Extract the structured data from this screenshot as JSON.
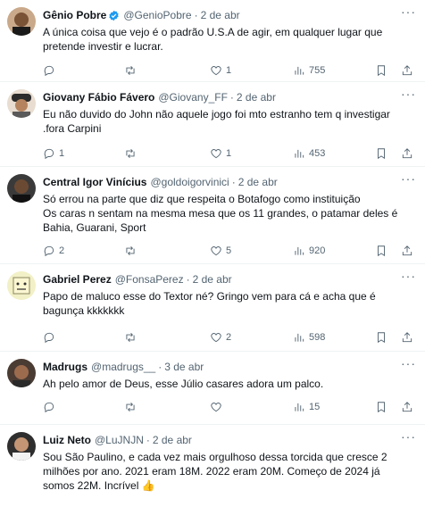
{
  "tweets": [
    {
      "name": "Gênio Pobre",
      "verified": true,
      "handle": "@GenioPobre",
      "date": "2 de abr",
      "lines": [
        "A única coisa que vejo é o padrão U.S.A de agir, em qualquer lugar que",
        "pretende investir e lucrar."
      ],
      "replies": "",
      "reposts": "",
      "likes": "1",
      "views": "755"
    },
    {
      "name": "Giovany Fábio Fávero",
      "verified": false,
      "handle": "@Giovany_FF",
      "date": "2 de abr",
      "lines": [
        "Eu não duvido do John não aquele jogo foi mto estranho tem q investigar",
        ".fora  Carpini"
      ],
      "replies": "1",
      "reposts": "",
      "likes": "1",
      "views": "453"
    },
    {
      "name": "Central Igor Vinícius",
      "verified": false,
      "handle": "@goldoigorvinici",
      "date": "2 de abr",
      "lines": [
        "Só errou na parte que diz que respeita o Botafogo como instituição",
        "Os caras n sentam na mesma mesa que os 11 grandes, o patamar deles é",
        "Bahia, Guarani, Sport"
      ],
      "replies": "2",
      "reposts": "",
      "likes": "5",
      "views": "920"
    },
    {
      "name": "Gabriel Perez",
      "verified": false,
      "handle": "@FonsaPerez",
      "date": "2 de abr",
      "lines": [
        "Papo de maluco esse do Textor né? Gringo vem para cá e acha que é",
        "bagunça kkkkkkk"
      ],
      "replies": "",
      "reposts": "",
      "likes": "2",
      "views": "598"
    },
    {
      "name": "Madrugs",
      "verified": false,
      "handle": "@madrugs__",
      "date": "3 de abr",
      "lines": [
        "Ah pelo amor de Deus, esse Júlio casares adora um palco."
      ],
      "replies": "",
      "reposts": "",
      "likes": "",
      "views": "15"
    },
    {
      "name": "Luiz Neto",
      "verified": false,
      "handle": "@LuJNJN",
      "date": "2 de abr",
      "lines": [
        "Sou São Paulino, e cada vez mais orgulhoso dessa torcida que cresce 2",
        "milhões por ano. 2021 eram 18M. 2022 eram 20M. Começo de 2024 já",
        "somos 22M. Incrível 👍"
      ],
      "replies": "",
      "reposts": "",
      "likes": "",
      "views": ""
    }
  ],
  "colors": {
    "verified": "#1d9bf0",
    "muted": "#536471",
    "text": "#0f1419",
    "divider": "#eff3f4"
  },
  "icons": [
    "verified-badge-icon",
    "more-icon",
    "reply-icon",
    "repost-icon",
    "like-icon",
    "views-icon",
    "bookmark-icon",
    "share-icon"
  ]
}
